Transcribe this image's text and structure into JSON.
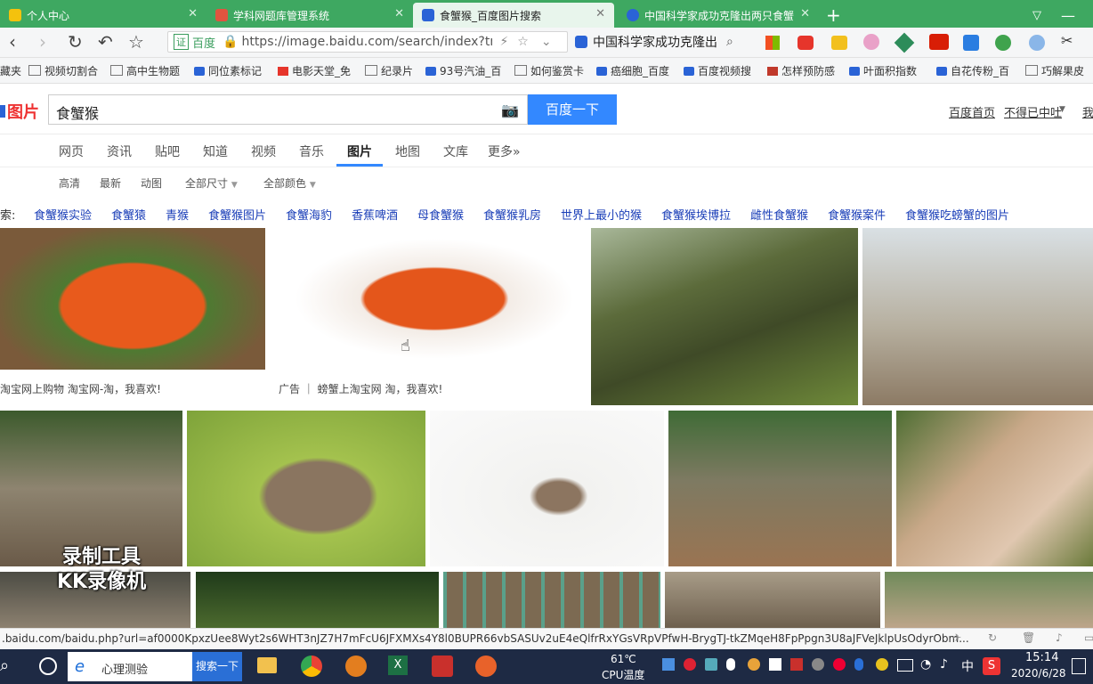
{
  "tabs": [
    {
      "label": "个人中心",
      "active": false,
      "color": "#f4c20d"
    },
    {
      "label": "学科网题库管理系统",
      "active": false,
      "color": "#e0543f"
    },
    {
      "label": "食蟹猴_百度图片搜索",
      "active": true,
      "color": "#2a63d6"
    },
    {
      "label": "中国科学家成功克隆出两只食蟹",
      "active": false,
      "color": "#2a63d6"
    }
  ],
  "nav": {
    "back": "‹",
    "forward": "›",
    "reload": "↻",
    "undo": "↶",
    "star": "☆",
    "cert_label": "证",
    "site_label": "百度",
    "url": "https://image.baidu.com/search/index?tn",
    "search_text": "中国科学家成功克隆出"
  },
  "bookmarks": [
    "藏夹",
    "视频切割合",
    "高中生物题",
    "同位素标记",
    "电影天堂_免",
    "纪录片",
    "93号汽油_百",
    "如何鉴赏卡",
    "癌细胞_百度",
    "百度视频搜",
    "怎样预防感",
    "叶面积指数",
    "自花传粉_百",
    "巧解果皮"
  ],
  "search": {
    "logo": "图片",
    "query": "食蟹猴",
    "button": "百度一下",
    "links": [
      "百度首页",
      "不得已中吐",
      "我"
    ]
  },
  "tabs_row": [
    "网页",
    "资讯",
    "贴吧",
    "知道",
    "视频",
    "音乐",
    "图片",
    "地图",
    "文库",
    "更多»"
  ],
  "tabs_row_active": "图片",
  "filters": [
    "高清",
    "最新",
    "动图",
    "全部尺寸",
    "全部颜色"
  ],
  "related": {
    "prefix": "索:",
    "items": [
      "食蟹猴实验",
      "食蟹猿",
      "青猴",
      "食蟹猴图片",
      "食蟹海豹",
      "香蕉啤酒",
      "母食蟹猴",
      "食蟹猴乳房",
      "世界上最小的猴",
      "食蟹猴埃博拉",
      "雌性食蟹猴",
      "食蟹猴案件",
      "食蟹猴吃螃蟹的图片"
    ]
  },
  "captions": {
    "ad1": "淘宝网上购物 淘宝网-淘，我喜欢!",
    "ad2_tag": "广告",
    "ad2": "螃蟹上淘宝网 淘，我喜欢!"
  },
  "watermark": [
    "录制工具",
    "KK录像机"
  ],
  "status": {
    "url": ".baidu.com/baidu.php?url=af0000KpxzUee8Wyt2s6WHT3nJZ7H7mFcU6JFXMXs4Y8l0BUPR66vbSASUv2uE4eQlfrRxYGsVRpVPfwH-BrygTJ-tkZMqeH8FpPpgn3U8aJFVeJklpUsOdyrObm..."
  },
  "taskbar": {
    "search_placeholder": "心理测验",
    "search_button": "搜索一下",
    "temp": "61℃",
    "temp_label": "CPU温度",
    "ime": "中",
    "time": "15:14",
    "date": "2020/6/28"
  }
}
